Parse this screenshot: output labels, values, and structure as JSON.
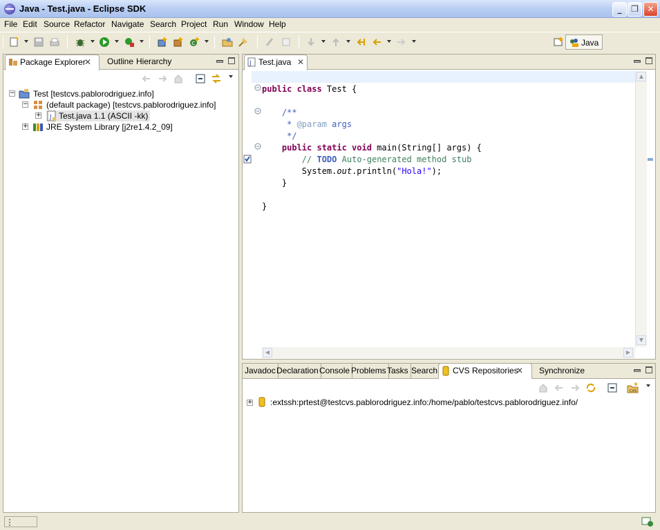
{
  "window": {
    "title": "Java - Test.java - Eclipse SDK"
  },
  "menu": [
    "File",
    "Edit",
    "Source",
    "Refactor",
    "Navigate",
    "Search",
    "Project",
    "Run",
    "Window",
    "Help"
  ],
  "perspective": {
    "label": "Java"
  },
  "left_panel": {
    "tabs": [
      "Package Explorer",
      "Outline",
      "Hierarchy"
    ],
    "tree": [
      {
        "label": "Test  [testcvs.pablorodriguez.info]"
      },
      {
        "label": "(default package)  [testcvs.pablorodriguez.info]"
      },
      {
        "label": "Test.java  1.1  (ASCII -kk)"
      },
      {
        "label": "JRE System Library [j2re1.4.2_09]"
      }
    ]
  },
  "editor": {
    "tab": "Test.java",
    "lines": [
      {
        "parts": [
          {
            "t": "public class",
            "c": "kw"
          },
          {
            "t": " Test {",
            "c": ""
          }
        ]
      },
      {
        "parts": []
      },
      {
        "parts": [
          {
            "t": "    /**",
            "c": "cm"
          }
        ]
      },
      {
        "parts": [
          {
            "t": "     * ",
            "c": "cm"
          },
          {
            "t": "@param",
            "c": "cm-tag"
          },
          {
            "t": " args",
            "c": "cm"
          }
        ]
      },
      {
        "parts": [
          {
            "t": "     */",
            "c": "cm"
          }
        ]
      },
      {
        "parts": [
          {
            "t": "    ",
            "c": ""
          },
          {
            "t": "public static void",
            "c": "kw"
          },
          {
            "t": " main(String[] args) {",
            "c": ""
          }
        ]
      },
      {
        "parts": [
          {
            "t": "        // ",
            "c": "cm2"
          },
          {
            "t": "TODO",
            "c": "todo"
          },
          {
            "t": " Auto-generated method stub",
            "c": "cm2"
          }
        ]
      },
      {
        "parts": [
          {
            "t": "        System.",
            "c": ""
          },
          {
            "t": "out",
            "c": "it"
          },
          {
            "t": ".println(",
            "c": ""
          },
          {
            "t": "\"Hola!\"",
            "c": "str"
          },
          {
            "t": ");",
            "c": ""
          }
        ]
      },
      {
        "parts": [
          {
            "t": "    }",
            "c": ""
          }
        ]
      },
      {
        "parts": []
      },
      {
        "parts": [
          {
            "t": "}",
            "c": ""
          }
        ]
      }
    ]
  },
  "bottom_panel": {
    "tabs": [
      "Javadoc",
      "Declaration",
      "Console",
      "Problems",
      "Tasks",
      "Search",
      "CVS Repositories",
      "Synchronize"
    ],
    "active_tab": "CVS Repositories",
    "repository": ":extssh:prtest@testcvs.pablorodriguez.info:/home/pablo/testcvs.pablorodriguez.info/"
  }
}
